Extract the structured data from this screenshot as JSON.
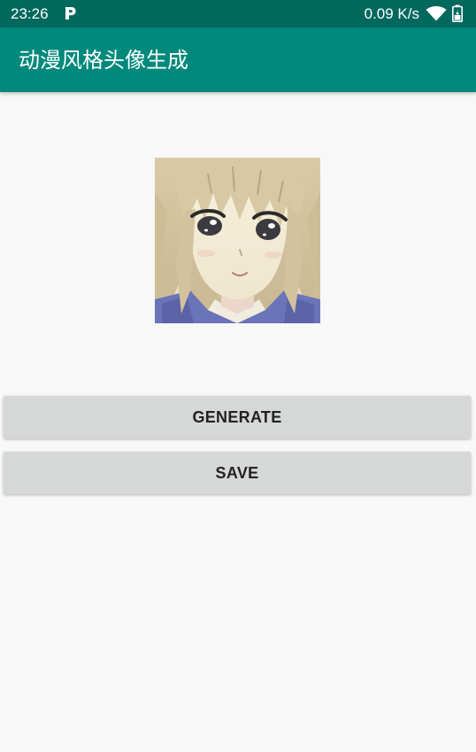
{
  "status_bar": {
    "time": "23:26",
    "network_speed": "0.09 K/s",
    "icons": [
      "parking-p-icon",
      "wifi-icon",
      "battery-icon"
    ]
  },
  "app_bar": {
    "title": "动漫风格头像生成"
  },
  "avatar": {
    "description_icon": "generated-anime-avatar-image"
  },
  "buttons": {
    "generate_label": "GENERATE",
    "save_label": "SAVE"
  },
  "colors": {
    "status_bar": "#00685d",
    "app_bar": "#00897b",
    "background": "#f8f8f8",
    "button": "#d6d7d7"
  }
}
